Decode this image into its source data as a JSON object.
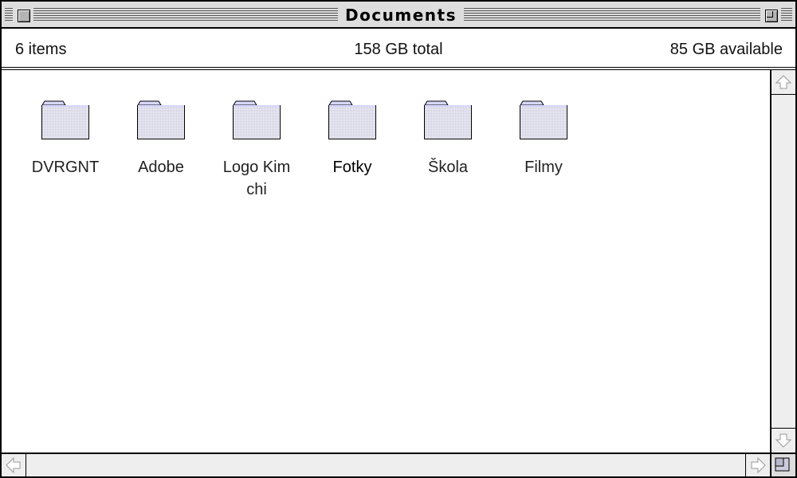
{
  "window": {
    "title": "Documents"
  },
  "info_bar": {
    "item_count": "6 items",
    "total": "158 GB total",
    "available": "85 GB available"
  },
  "items": [
    {
      "label": "DVRGNT",
      "icon": "folder-icon"
    },
    {
      "label": "Adobe",
      "icon": "folder-icon"
    },
    {
      "label": "Logo Kim chi",
      "icon": "folder-icon"
    },
    {
      "label": "Fotky",
      "icon": "folder-icon"
    },
    {
      "label": "Škola",
      "icon": "folder-icon"
    },
    {
      "label": "Filmy",
      "icon": "folder-icon"
    }
  ],
  "colors": {
    "titlebar": "#dddddd",
    "folder_tab": "#d8d8ff",
    "folder_body": "#e8e8f4",
    "scrollbar": "#eeeeee"
  }
}
